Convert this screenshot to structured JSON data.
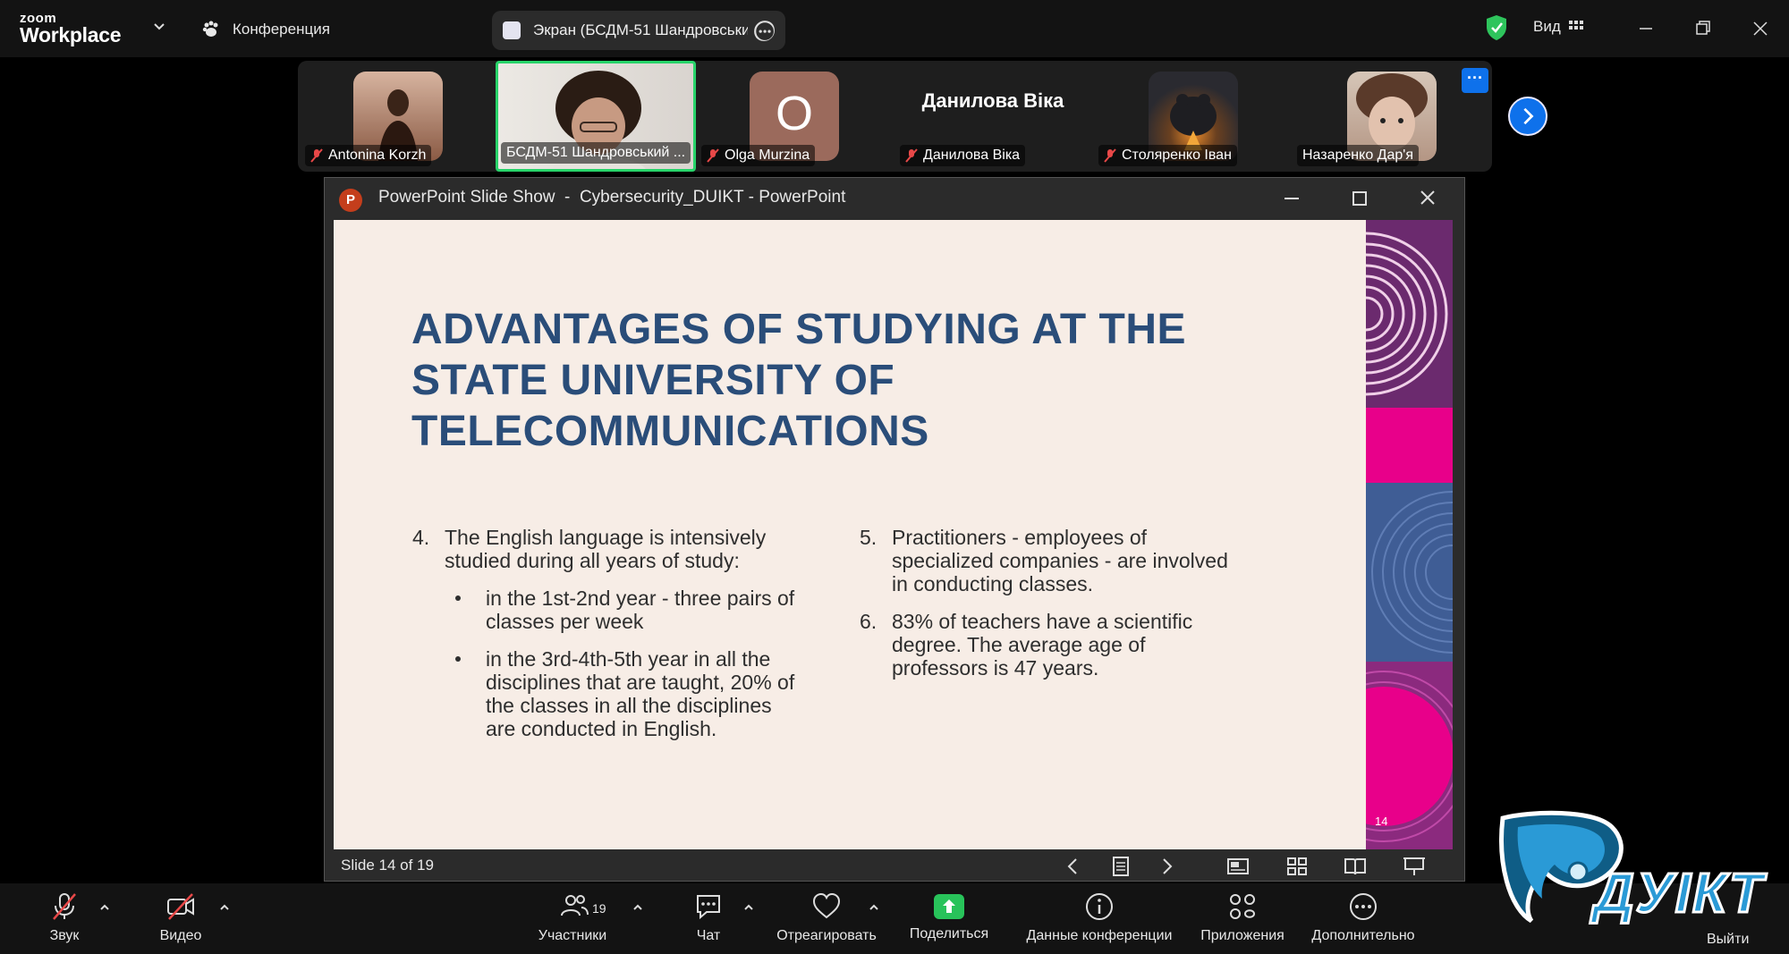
{
  "app": {
    "brand_top": "zoom",
    "brand_bottom": "Workplace"
  },
  "topbar": {
    "meeting_label": "Конференция",
    "share_label": "Экран (БСДМ-51 Шандровськи",
    "view_label": "Вид"
  },
  "participants": [
    {
      "name": "Antonina Korzh",
      "muted": true
    },
    {
      "name": "БСДМ-51 Шандровський ...",
      "muted": false,
      "active_speaker": true
    },
    {
      "name": "Olga Murzina",
      "muted": true,
      "initial": "O"
    },
    {
      "name": "Данилова Віка",
      "muted": true,
      "display_name": "Данилова Віка"
    },
    {
      "name": "Столяренко Іван",
      "muted": true
    },
    {
      "name": "Назаренко Дар'я",
      "muted": false
    }
  ],
  "strip": {
    "more_label": "···"
  },
  "ppt": {
    "window_title": "PowerPoint Slide Show  -  Cybersecurity_DUIKT - PowerPoint",
    "icon_letter": "P",
    "status": "Slide 14 of 19",
    "slide": {
      "title_lines": [
        "ADVANTAGES OF STUDYING AT THE",
        "STATE UNIVERSITY OF",
        "TELECOMMUNICATIONS"
      ],
      "item4": {
        "num": "4.",
        "lines": [
          "The English language is intensively",
          "studied during all years of study:"
        ]
      },
      "bullet1": [
        "in the 1st-2nd year - three pairs of",
        "classes per week"
      ],
      "bullet2": [
        "in the 3rd-4th-5th year in all the",
        "disciplines that are taught, 20% of",
        "the classes in all the disciplines",
        "are conducted in English."
      ],
      "item5": {
        "num": "5.",
        "lines": [
          "Practitioners - employees of",
          "specialized companies - are involved",
          "in conducting classes."
        ]
      },
      "item6": {
        "num": "6.",
        "lines": [
          "83% of teachers have a scientific",
          "degree. The average age of",
          "professors is 47 years."
        ]
      },
      "page_number": "14"
    }
  },
  "toolbar": {
    "audio": "Звук",
    "video": "Видео",
    "participants": "Участники",
    "participants_count": "19",
    "chat": "Чат",
    "react": "Отреагировать",
    "share": "Поделиться",
    "info": "Данные конференции",
    "apps": "Приложения",
    "more": "Дополнительно",
    "leave": "Выйти"
  },
  "watermark": {
    "text": "ДУІКТ"
  },
  "colors": {
    "accent": "#0e71eb",
    "share_green": "#28c35a",
    "slide_title": "#2a4d79",
    "slide_bg": "#f7ede6",
    "magenta": "#e8008a"
  }
}
